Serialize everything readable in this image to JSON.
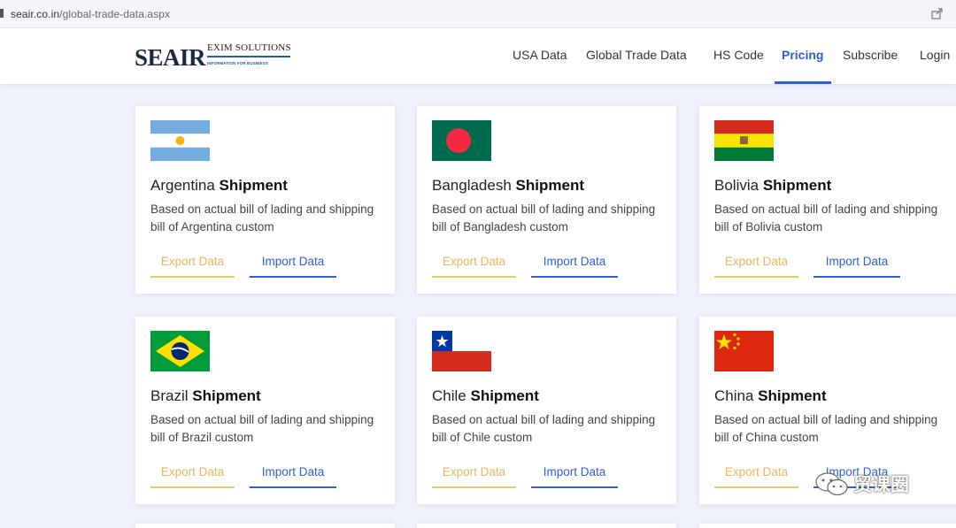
{
  "browser": {
    "url_domain": "seair.co.in",
    "url_path": "/global-trade-data.aspx"
  },
  "logo": {
    "main": "SEAIR",
    "sub": "EXIM SOLUTIONS",
    "tag": "INFORMATION FOR BUSINESS"
  },
  "nav": {
    "usa": "USA Data",
    "global": "Global Trade Data",
    "hs": "HS Code",
    "pricing": "Pricing",
    "subscribe": "Subscribe",
    "login": "Login"
  },
  "cards": [
    {
      "country": "Argentina",
      "suffix": "Shipment",
      "desc": "Based on actual bill of lading and shipping bill of Argentina custom",
      "export": "Export Data",
      "import": "Import Data"
    },
    {
      "country": "Bangladesh",
      "suffix": "Shipment",
      "desc": "Based on actual bill of lading and shipping bill of Bangladesh custom",
      "export": "Export Data",
      "import": "Import Data"
    },
    {
      "country": "Bolivia",
      "suffix": "Shipment",
      "desc": "Based on actual bill of lading and shipping bill of Bolivia custom",
      "export": "Export Data",
      "import": "Import Data"
    },
    {
      "country": "Brazil",
      "suffix": "Shipment",
      "desc": "Based on actual bill of lading and shipping bill of Brazil custom",
      "export": "Export Data",
      "import": "Import Data"
    },
    {
      "country": "Chile",
      "suffix": "Shipment",
      "desc": "Based on actual bill of lading and shipping bill of Chile custom",
      "export": "Export Data",
      "import": "Import Data"
    },
    {
      "country": "China",
      "suffix": "Shipment",
      "desc": "Based on actual bill of lading and shipping bill of China custom",
      "export": "Export Data",
      "import": "Import Data"
    }
  ],
  "watermark": "贸课圈",
  "colors": {
    "accent": "#2d5fd0",
    "export": "#e8b65c",
    "background": "#eef0fb"
  }
}
